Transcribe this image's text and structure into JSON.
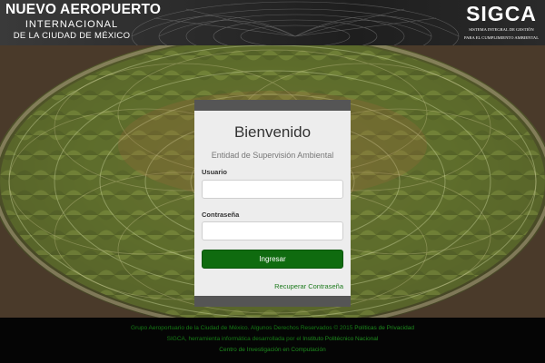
{
  "header": {
    "brand": {
      "line1": "NUEVO AEROPUERTO",
      "line2": "INTERNACIONAL",
      "line3": "DE LA CIUDAD DE MÉXICO"
    },
    "sigca": {
      "logo": "SIGCA",
      "sub1": "SISTEMA INTEGRAL DE GESTIÓN",
      "sub2": "PARA EL CUMPLIMIENTO AMBIENTAL"
    }
  },
  "login": {
    "title": "Bienvenido",
    "subtitle": "Entidad de Supervisión Ambiental",
    "user_label": "Usuario",
    "user_value": "",
    "password_label": "Contraseña",
    "password_value": "",
    "submit_label": "Ingresar",
    "recover_link": "Recuperar Contraseña"
  },
  "footer": {
    "line1_text": "Grupo Aeroportuario de la Ciudad de México. Algunos Derechos Reservados © 2015",
    "line1_link": "Políticas de Privacidad",
    "line2_text": "SIGCA, herramienta informática desarrollada por el",
    "line2_link": "Instituto Politécnico Nacional",
    "line3_link": "Centro de Investigación en Computación"
  },
  "colors": {
    "accent_green": "#0f6b0f",
    "card_border": "#555555",
    "footer_text": "#157a15"
  }
}
